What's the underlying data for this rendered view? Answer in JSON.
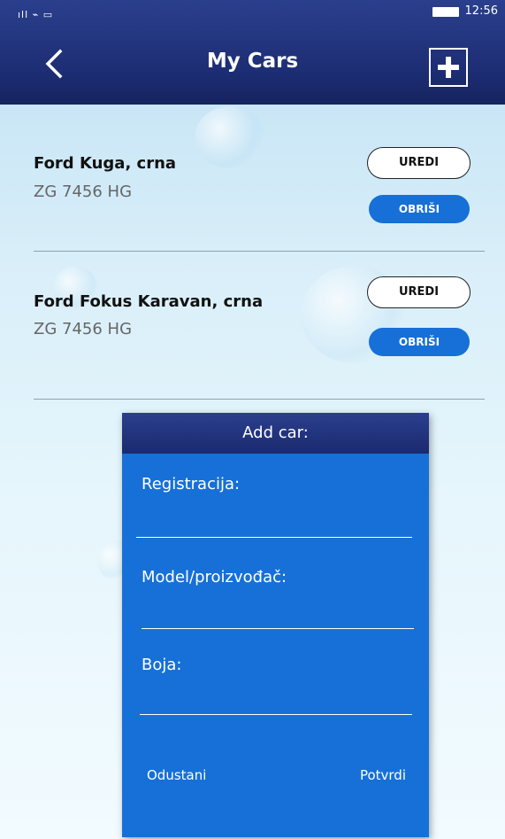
{
  "status_bar": {
    "signal": "ıll ⌁ ▭",
    "time": "12:56"
  },
  "header": {
    "title": "My Cars",
    "back_icon": "chevron-left-icon",
    "add_icon": "plus-box-icon"
  },
  "cars": [
    {
      "name": "Ford Kuga, crna",
      "plate": "ZG 7456 HG",
      "edit_label": "UREDI",
      "delete_label": "OBRIŠI"
    },
    {
      "name": "Ford Fokus Karavan, crna",
      "plate": "ZG 7456 HG",
      "edit_label": "UREDI",
      "delete_label": "OBRIŠI"
    }
  ],
  "dialog": {
    "title": "Add car:",
    "fields": [
      {
        "label": "Registracija:",
        "value": ""
      },
      {
        "label": "Model/proizvođač:",
        "value": ""
      },
      {
        "label": "Boja:",
        "value": ""
      }
    ],
    "cancel_label": "Odustani",
    "confirm_label": "Potvrdi"
  },
  "colors": {
    "header": "#1d2d73",
    "accent": "#1670d8",
    "background": "#d8eef9"
  }
}
